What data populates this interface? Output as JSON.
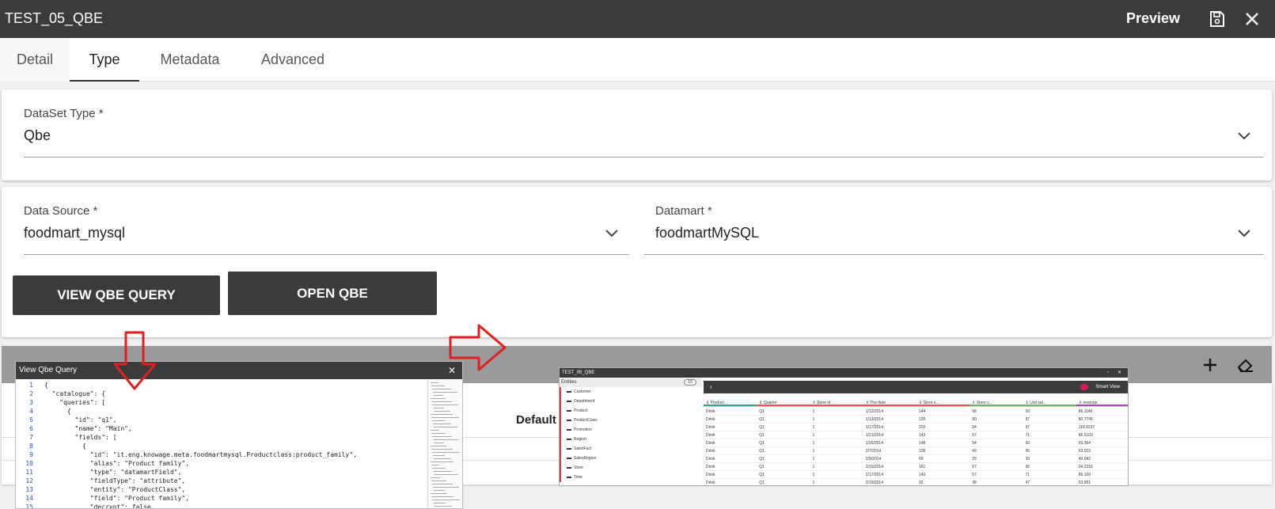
{
  "header": {
    "title": "TEST_05_QBE",
    "preview_label": "Preview",
    "icons": [
      "save-icon",
      "close-icon"
    ]
  },
  "tabs": [
    {
      "label": "Detail"
    },
    {
      "label": "Type",
      "active": true
    },
    {
      "label": "Metadata"
    },
    {
      "label": "Advanced"
    }
  ],
  "dataset_type": {
    "label": "DataSet Type *",
    "value": "Qbe"
  },
  "data_source": {
    "label": "Data Source *",
    "value": "foodmart_mysql"
  },
  "datamart": {
    "label": "Datamart *",
    "value": "foodmartMySQL"
  },
  "buttons": {
    "view_qbe_query": "VIEW QBE QUERY",
    "open_qbe": "OPEN QBE"
  },
  "parameters": {
    "default_label": "Default",
    "icons": [
      "plus-icon",
      "eraser-icon"
    ]
  },
  "colors": {
    "dark": "#3b3b3b",
    "arrow": "#e02020",
    "bar": "#9a9a9a"
  },
  "qbe_query_popup": {
    "title": "View Qbe Query",
    "lines": [
      {
        "n": "1",
        "t": "{"
      },
      {
        "n": "2",
        "t": "  \"catalogue\": {"
      },
      {
        "n": "3",
        "t": "    \"queries\": ["
      },
      {
        "n": "4",
        "t": "      {"
      },
      {
        "n": "5",
        "t": "        \"id\": \"q1\","
      },
      {
        "n": "6",
        "t": "        \"name\": \"Main\","
      },
      {
        "n": "7",
        "t": "        \"fields\": ["
      },
      {
        "n": "8",
        "t": "          {"
      },
      {
        "n": "9",
        "t": "            \"id\": \"it.eng.knowage.meta.foodmartmysql.Productclass:product_family\","
      },
      {
        "n": "10",
        "t": "            \"alias\": \"Product family\","
      },
      {
        "n": "11",
        "t": "            \"type\": \"datamartField\","
      },
      {
        "n": "12",
        "t": "            \"fieldType\": \"attribute\","
      },
      {
        "n": "13",
        "t": "            \"entity\": \"ProductClass\","
      },
      {
        "n": "14",
        "t": "            \"field\": \"Product family\","
      },
      {
        "n": "15",
        "t": "            \"decrypt\": false,"
      }
    ]
  },
  "qbe_window": {
    "title": "TEST_05_QBE",
    "entities_label": "Entities",
    "entities_count": "10",
    "entities": [
      "Customer",
      "Department",
      "Product",
      "ProductClass",
      "Promotion",
      "Region",
      "SalesFact",
      "SalesRegion",
      "Store",
      "Time"
    ],
    "smart_view_label": "Smart View",
    "columns": [
      "Product...",
      "Quarter",
      "Store id",
      "The date",
      "Store s...",
      "Store c...",
      "Unit sal...",
      "revenue"
    ],
    "column_colors": [
      "#26a69a",
      "#ef5350",
      "#ef5350",
      "#ef5350",
      "#ef5350",
      "#66bb6a",
      "#66bb6a",
      "#ab47bc"
    ],
    "rows": [
      [
        "Drink",
        "Q1",
        "1",
        "1/12/2014",
        "144",
        "58",
        "69",
        "86.1149"
      ],
      [
        "Drink",
        "Q1",
        "1",
        "1/13/2014",
        "130",
        "90",
        "67",
        "80.7745"
      ],
      [
        "Drink",
        "Q1",
        "1",
        "1/17/2014",
        "203",
        "84",
        "97",
        "118.9237"
      ],
      [
        "Drink",
        "Q1",
        "1",
        "1/21/2014",
        "143",
        "57",
        "71",
        "85.6103"
      ],
      [
        "Drink",
        "Q1",
        "1",
        "1/26/2014",
        "148",
        "54",
        "69",
        "93.354"
      ],
      [
        "Drink",
        "Q1",
        "1",
        "2/7/2014",
        "106",
        "43",
        "56",
        "63.023"
      ],
      [
        "Drink",
        "Q1",
        "1",
        "2/9/2014",
        "69",
        "29",
        "39",
        "40.042"
      ],
      [
        "Drink",
        "Q1",
        "1",
        "2/15/2014",
        "161",
        "67",
        "66",
        "94.2316"
      ],
      [
        "Drink",
        "Q1",
        "1",
        "2/17/2014",
        "143",
        "57",
        "71",
        "86.109"
      ],
      [
        "Drink",
        "Q1",
        "1",
        "2/19/2014",
        "92",
        "38",
        "47",
        "53.891"
      ]
    ]
  }
}
